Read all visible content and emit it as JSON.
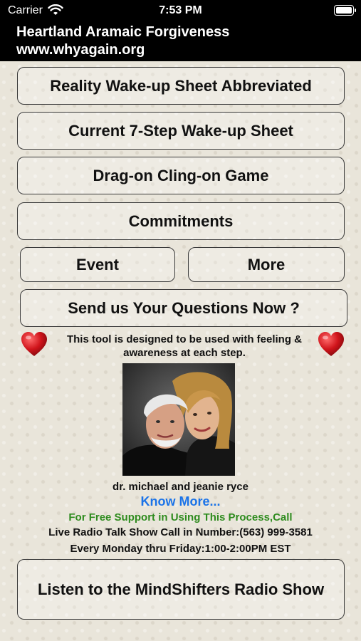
{
  "status_bar": {
    "carrier": "Carrier",
    "time": "7:53 PM"
  },
  "header": {
    "title": "Heartland Aramaic Forgiveness",
    "url": "www.whyagain.org"
  },
  "buttons": {
    "reality": "Reality Wake-up Sheet Abbreviated",
    "current": "Current 7-Step Wake-up Sheet",
    "drag": "Drag-on Cling-on Game",
    "commitments": "Commitments",
    "event": "Event",
    "more": "More",
    "questions": "Send us Your Questions Now ?",
    "listen": "Listen to the MindShifters Radio Show"
  },
  "info_text": {
    "line1": "This tool is designed to be used with feeling &",
    "line2": "awareness at each step."
  },
  "caption": "dr. michael and jeanie ryce",
  "know_more": "Know More...",
  "support_text": "For Free Support in Using This Process,Call",
  "radio_call": "Live Radio Talk Show Call in Number:(563) 999-3581",
  "schedule": "Every Monday thru Friday:1:00-2:00PM EST",
  "colors": {
    "link": "#1a73e8",
    "support": "#2e8b1e",
    "heart": "#d0141b"
  },
  "icons": [
    "wifi-icon",
    "battery-icon",
    "heart-icon"
  ]
}
